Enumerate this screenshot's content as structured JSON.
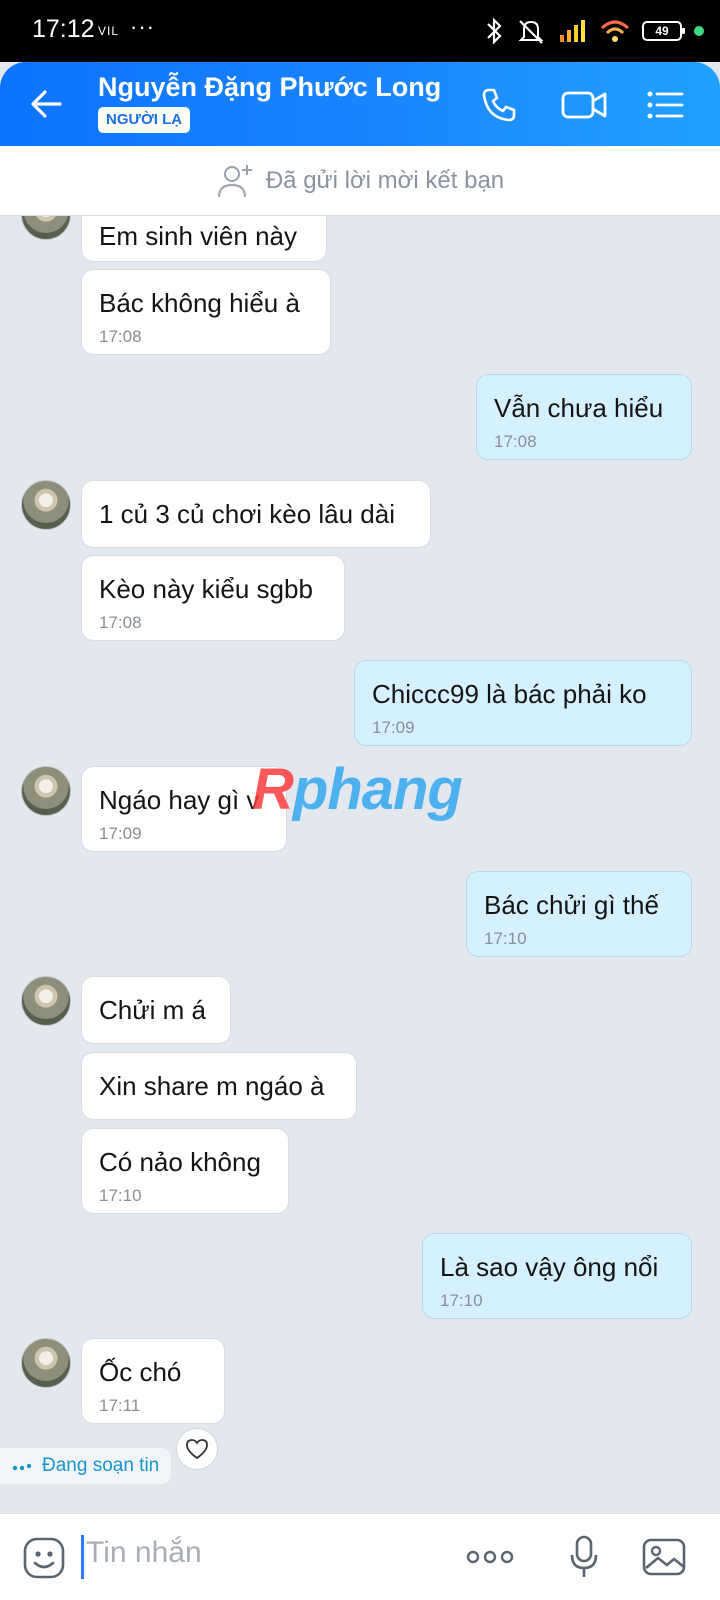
{
  "status_bar": {
    "time": "17:12",
    "network": "VIL",
    "more": "···",
    "battery": "49"
  },
  "header": {
    "contact_name": "Nguyễn Đặng Phước Long",
    "badge": "NGƯỜI LẠ",
    "accent_color": "#0c73ff"
  },
  "friend_request": {
    "text": "Đã gửi lời mời kết bạn"
  },
  "messages": [
    {
      "side": "in",
      "text": "Em sinh viên này",
      "time": ""
    },
    {
      "side": "in",
      "text": "Bác không hiểu à",
      "time": "17:08"
    },
    {
      "side": "out",
      "text": "Vẫn chưa hiểu",
      "time": "17:08"
    },
    {
      "side": "in",
      "text": "1 củ 3 củ chơi kèo lâu dài",
      "time": ""
    },
    {
      "side": "in",
      "text": "Kèo này kiểu sgbb",
      "time": "17:08"
    },
    {
      "side": "out",
      "text": "Chiccc99 là bác phải ko",
      "time": "17:09"
    },
    {
      "side": "in",
      "text": "Ngáo hay gì v",
      "time": "17:09"
    },
    {
      "side": "out",
      "text": "Bác chửi gì thế",
      "time": "17:10"
    },
    {
      "side": "in",
      "text": "Chửi m á",
      "time": ""
    },
    {
      "side": "in",
      "text": "Xin share m ngáo à",
      "time": ""
    },
    {
      "side": "in",
      "text": "Có nảo không",
      "time": "17:10"
    },
    {
      "side": "out",
      "text": "Là sao vậy ông nổi",
      "time": "17:10"
    },
    {
      "side": "in",
      "text": "Ốc chó",
      "time": "17:11"
    }
  ],
  "typing_indicator": "Đang soạn tin",
  "watermark": {
    "first": "R",
    "rest": "phang"
  },
  "input": {
    "placeholder": "Tin nhắn"
  },
  "icons": {
    "back": "arrow-left-icon",
    "call": "phone-icon",
    "video": "video-camera-icon",
    "menu": "list-menu-icon",
    "add_friend": "add-user-icon",
    "react": "heart-icon",
    "emoji": "sticker-smile-icon",
    "more": "more-dots-icon",
    "mic": "microphone-icon",
    "gallery": "image-gallery-icon"
  }
}
